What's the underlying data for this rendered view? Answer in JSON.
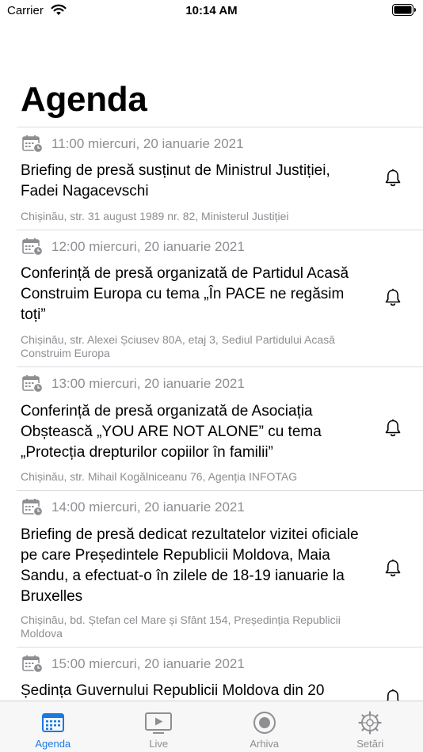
{
  "status_bar": {
    "carrier": "Carrier",
    "time": "10:14 AM"
  },
  "page": {
    "title": "Agenda"
  },
  "events": [
    {
      "time": "11:00 miercuri, 20 ianuarie 2021",
      "title": "Briefing de presă susținut de Ministrul Justiției, Fadei Nagacevschi",
      "location": "Chișinău, str. 31 august 1989 nr. 82, Ministerul Justiției"
    },
    {
      "time": "12:00 miercuri, 20 ianuarie 2021",
      "title": "Conferință de presă organizată de Partidul Acasă Construim Europa cu tema „În PACE ne regăsim toți”",
      "location": "Chișinău, str. Alexei Șciusev 80A, etaj 3, Sediul Partidului Acasă Construim Europa"
    },
    {
      "time": "13:00 miercuri, 20 ianuarie 2021",
      "title": "Conferință de presă organizată de Asociația Obștească „YOU ARE NOT ALONE” cu tema „Protecția drepturilor copiilor în familii”",
      "location": "Chișinău, str. Mihail Kogălniceanu 76, Agenția INFOTAG"
    },
    {
      "time": "14:00 miercuri, 20 ianuarie 2021",
      "title": "Briefing de presă dedicat rezultatelor vizitei oficiale pe care Președintele Republicii Moldova, Maia Sandu, a efectuat-o în zilele de 18-19 ianuarie la Bruxelles",
      "location": "Chișinău, bd. Ștefan cel Mare și Sfânt 154, Președinția Republicii Moldova"
    },
    {
      "time": "15:00 miercuri, 20 ianuarie 2021",
      "title": "Ședința Guvernului Republicii Moldova din 20",
      "location": ""
    }
  ],
  "tab_bar": {
    "tabs": [
      {
        "label": "Agenda",
        "icon": "calendar-icon",
        "active": true
      },
      {
        "label": "Live",
        "icon": "play-icon",
        "active": false
      },
      {
        "label": "Arhiva",
        "icon": "record-icon",
        "active": false
      },
      {
        "label": "Setări",
        "icon": "gear-icon",
        "active": false
      }
    ]
  },
  "colors": {
    "accent": "#1a7ae0",
    "inactive_tab": "#8e8e93",
    "secondary_text": "#8e8e93",
    "separator": "#dcdce0"
  }
}
